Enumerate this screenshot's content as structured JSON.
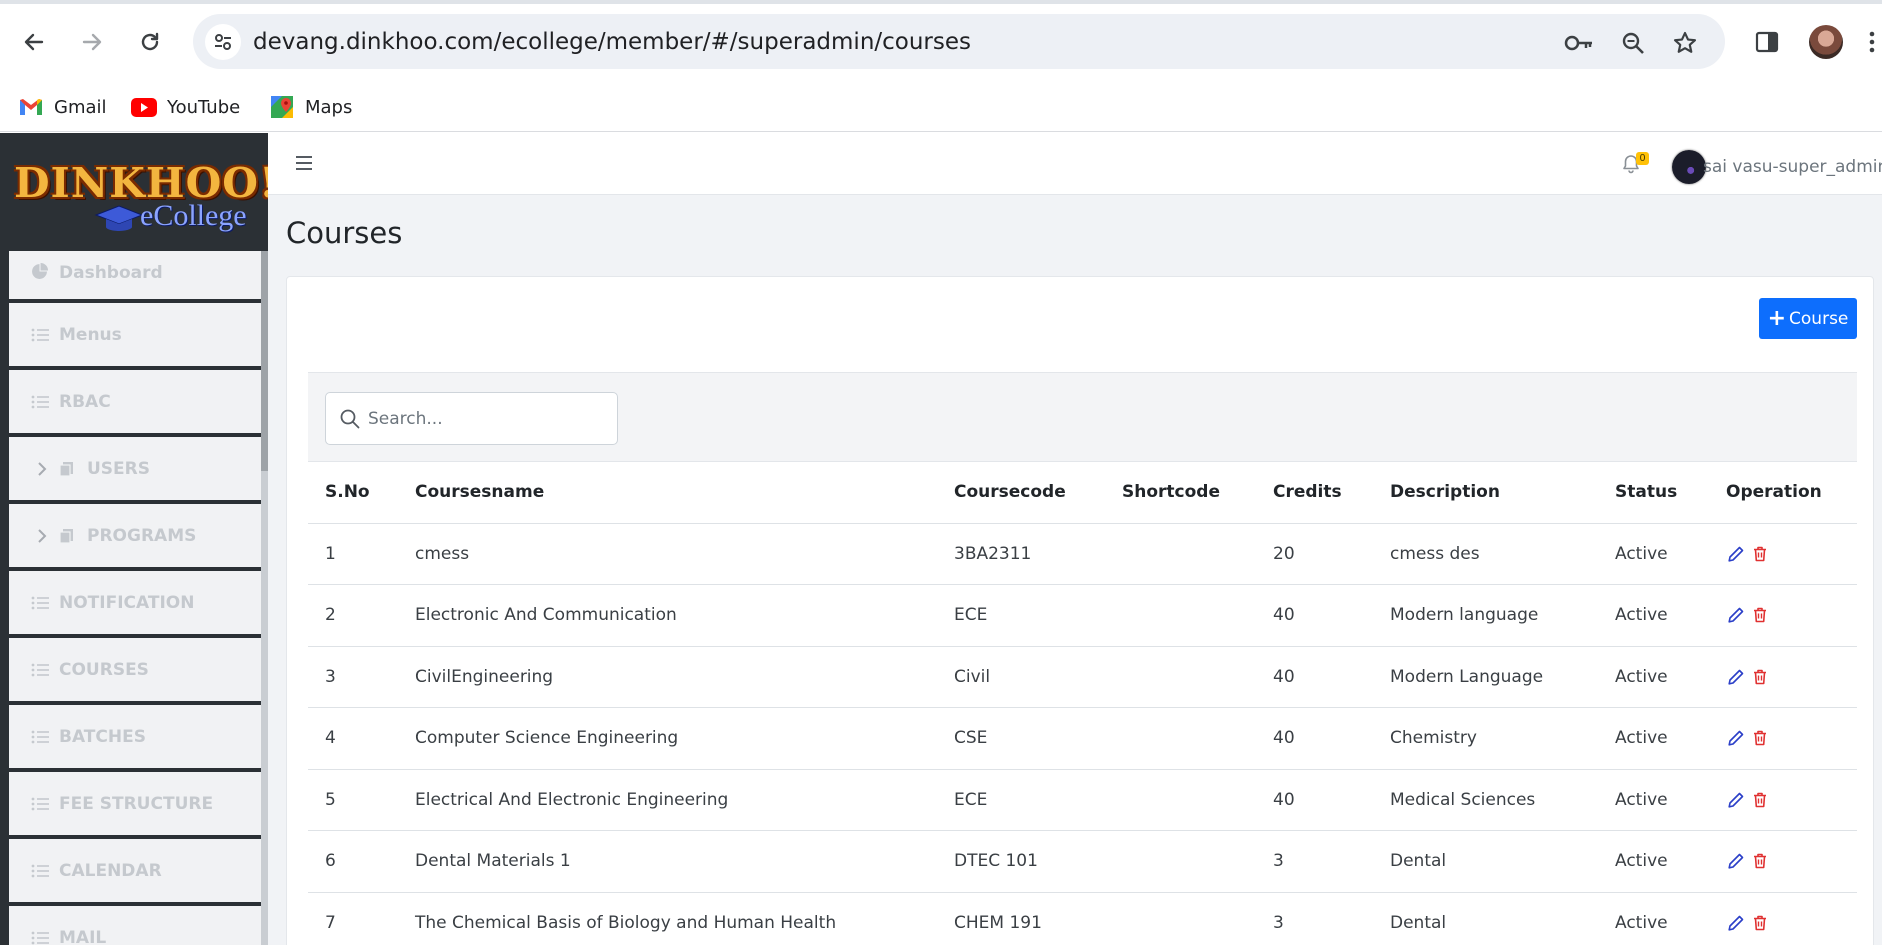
{
  "browser": {
    "url": "devang.dinkhoo.com/ecollege/member/#/superadmin/courses",
    "bookmarks": [
      {
        "label": "Gmail",
        "icon": "gmail-icon"
      },
      {
        "label": "YouTube",
        "icon": "youtube-icon"
      },
      {
        "label": "Maps",
        "icon": "maps-icon"
      }
    ]
  },
  "sidebar": {
    "logo_text": "DINKHOO!",
    "logo_sub": "eCollege",
    "items": [
      {
        "label": "Dashboard",
        "icon": "pie-chart-icon"
      },
      {
        "label": "Menus",
        "icon": "list-icon"
      },
      {
        "label": "RBAC",
        "icon": "list-icon"
      },
      {
        "label": "USERS",
        "icon": "copy-icon"
      },
      {
        "label": "PROGRAMS",
        "icon": "copy-icon"
      },
      {
        "label": "NOTIFICATION",
        "icon": "list-icon"
      },
      {
        "label": "COURSES",
        "icon": "list-icon"
      },
      {
        "label": "BATCHES",
        "icon": "list-icon"
      },
      {
        "label": "FEE STRUCTURE",
        "icon": "list-icon"
      },
      {
        "label": "CALENDAR",
        "icon": "list-icon"
      },
      {
        "label": "MAIL",
        "icon": "list-icon"
      }
    ]
  },
  "topbar": {
    "notification_count": "0",
    "user_name": "sai vasu-super_admin"
  },
  "page": {
    "title": "Courses",
    "add_button_label": "Course",
    "search_placeholder": "Search..."
  },
  "table": {
    "columns": [
      "S.No",
      "Coursesname",
      "Coursecode",
      "Shortcode",
      "Credits",
      "Description",
      "Status",
      "Operation"
    ],
    "rows": [
      {
        "sno": "1",
        "name": "cmess",
        "code": "3BA2311",
        "shortcode": "",
        "credits": "20",
        "description": "cmess des",
        "status": "Active"
      },
      {
        "sno": "2",
        "name": "Electronic And Communication",
        "code": "ECE",
        "shortcode": "",
        "credits": "40",
        "description": "Modern language",
        "status": "Active"
      },
      {
        "sno": "3",
        "name": "CivilEngineering",
        "code": "Civil",
        "shortcode": "",
        "credits": "40",
        "description": "Modern Language",
        "status": "Active"
      },
      {
        "sno": "4",
        "name": "Computer Science Engineering",
        "code": "CSE",
        "shortcode": "",
        "credits": "40",
        "description": "Chemistry",
        "status": "Active"
      },
      {
        "sno": "5",
        "name": "Electrical And Electronic Engineering",
        "code": "ECE",
        "shortcode": "",
        "credits": "40",
        "description": "Medical Sciences",
        "status": "Active"
      },
      {
        "sno": "6",
        "name": "Dental Materials 1",
        "code": "DTEC 101",
        "shortcode": "",
        "credits": "3",
        "description": "Dental",
        "status": "Active"
      },
      {
        "sno": "7",
        "name": "The Chemical Basis of Biology and Human Health",
        "code": "CHEM 191",
        "shortcode": "",
        "credits": "3",
        "description": "Dental",
        "status": "Active"
      }
    ]
  },
  "colors": {
    "primary": "#0d6efd",
    "sidebar_bg": "#2b3035",
    "edit_icon": "#2b3fc8",
    "delete_icon": "#e03131",
    "badge": "#ffc107"
  }
}
